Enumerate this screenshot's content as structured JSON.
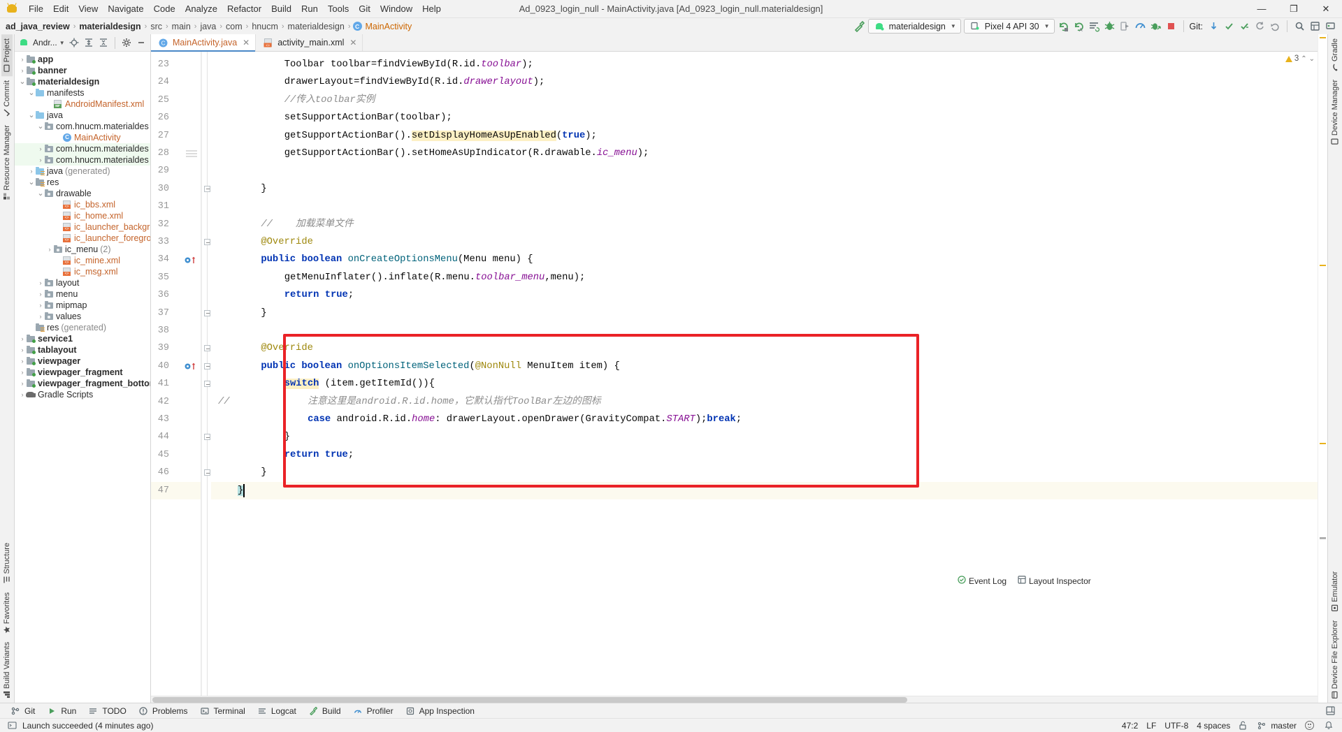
{
  "window": {
    "title": "Ad_0923_login_null - MainActivity.java [Ad_0923_login_null.materialdesign]",
    "minimize": "—",
    "maximize": "❐",
    "close": "✕"
  },
  "menubar": {
    "items": [
      {
        "label": "File"
      },
      {
        "label": "Edit"
      },
      {
        "label": "View"
      },
      {
        "label": "Navigate"
      },
      {
        "label": "Code"
      },
      {
        "label": "Analyze"
      },
      {
        "label": "Refactor"
      },
      {
        "label": "Build"
      },
      {
        "label": "Run"
      },
      {
        "label": "Tools"
      },
      {
        "label": "Git"
      },
      {
        "label": "Window"
      },
      {
        "label": "Help"
      }
    ]
  },
  "breadcrumb": {
    "items": [
      {
        "label": "ad_java_review",
        "style": "bold"
      },
      {
        "label": "materialdesign",
        "style": "bold"
      },
      {
        "label": "src",
        "style": "dim"
      },
      {
        "label": "main",
        "style": "dim"
      },
      {
        "label": "java",
        "style": "dim"
      },
      {
        "label": "com",
        "style": "dim"
      },
      {
        "label": "hnucm",
        "style": "dim"
      },
      {
        "label": "materialdesign",
        "style": "dim"
      },
      {
        "label": "MainActivity",
        "style": "class"
      }
    ],
    "separator": "›",
    "class_badge": "C"
  },
  "toolbar": {
    "run_config": "materialdesign",
    "device": "Pixel 4 API 30",
    "git_label": "Git:",
    "icons": [
      "hammer-build-icon",
      "run-icon",
      "run-with-coverage-icon",
      "run-tests-icon",
      "debug-icon",
      "attach-debugger-icon",
      "profiler-icon",
      "apply-changes-icon",
      "stop-icon",
      "git-update-icon",
      "git-commit-icon",
      "git-push-icon",
      "git-history-icon",
      "undo-icon",
      "search-everywhere-icon",
      "project-structure-icon",
      "settings-icon",
      "sdk-manager-icon"
    ]
  },
  "left_strip": {
    "top": [
      {
        "label": "Project",
        "icon": "project-icon",
        "selected": true
      },
      {
        "label": "Commit",
        "icon": "commit-icon",
        "selected": false
      },
      {
        "label": "Resource Manager",
        "icon": "resource-manager-icon",
        "selected": false
      }
    ],
    "bottom": [
      {
        "label": "Structure",
        "icon": "structure-icon"
      },
      {
        "label": "Favorites",
        "icon": "favorites-star-icon"
      },
      {
        "label": "Build Variants",
        "icon": "build-variants-icon"
      }
    ]
  },
  "right_strip": {
    "items": [
      {
        "label": "Gradle",
        "icon": "gradle-icon"
      },
      {
        "label": "Device Manager",
        "icon": "device-manager-icon"
      },
      {
        "label": "Emulator",
        "icon": "emulator-icon"
      },
      {
        "label": "Device File Explorer",
        "icon": "device-file-explorer-icon"
      }
    ]
  },
  "project_panel": {
    "title": "Andr...",
    "header_icons": [
      "locate-icon",
      "expand-all-icon",
      "collapse-all-icon",
      "gear-icon",
      "hide-icon"
    ],
    "tree": [
      {
        "indent": 0,
        "arrow": "›",
        "icon": "module-folder",
        "label": "app",
        "style": "bold"
      },
      {
        "indent": 0,
        "arrow": "›",
        "icon": "module-folder",
        "label": "banner",
        "style": "bold"
      },
      {
        "indent": 0,
        "arrow": "⌄",
        "icon": "module-folder",
        "label": "materialdesign",
        "style": "bold"
      },
      {
        "indent": 1,
        "arrow": "⌄",
        "icon": "blue-folder",
        "label": "manifests",
        "style": "plain"
      },
      {
        "indent": 3,
        "arrow": "",
        "icon": "manifest-file",
        "label": "AndroidManifest.xml",
        "style": "orange"
      },
      {
        "indent": 1,
        "arrow": "⌄",
        "icon": "blue-folder",
        "label": "java",
        "style": "plain"
      },
      {
        "indent": 2,
        "arrow": "⌄",
        "icon": "package",
        "label": "com.hnucm.materialdes",
        "style": "plain"
      },
      {
        "indent": 4,
        "arrow": "",
        "icon": "class-file",
        "label": "MainActivity",
        "style": "orange"
      },
      {
        "indent": 2,
        "arrow": "›",
        "icon": "package",
        "label": "com.hnucm.materialdes",
        "style": "plain",
        "row": "hl"
      },
      {
        "indent": 2,
        "arrow": "›",
        "icon": "package",
        "label": "com.hnucm.materialdes",
        "style": "plain",
        "row": "hl"
      },
      {
        "indent": 1,
        "arrow": "›",
        "icon": "gen-folder",
        "label": "java",
        "suffix": "(generated)",
        "style": "plain"
      },
      {
        "indent": 1,
        "arrow": "⌄",
        "icon": "res-folder",
        "label": "res",
        "style": "plain"
      },
      {
        "indent": 2,
        "arrow": "⌄",
        "icon": "package",
        "label": "drawable",
        "style": "plain"
      },
      {
        "indent": 4,
        "arrow": "",
        "icon": "xml-file",
        "label": "ic_bbs.xml",
        "style": "orange"
      },
      {
        "indent": 4,
        "arrow": "",
        "icon": "xml-file",
        "label": "ic_home.xml",
        "style": "orange"
      },
      {
        "indent": 4,
        "arrow": "",
        "icon": "xml-file",
        "label": "ic_launcher_backgrou",
        "style": "orange"
      },
      {
        "indent": 4,
        "arrow": "",
        "icon": "xml-file",
        "label": "ic_launcher_foregrou",
        "style": "orange"
      },
      {
        "indent": 3,
        "arrow": "›",
        "icon": "package",
        "label": "ic_menu",
        "suffix": "(2)",
        "style": "plain"
      },
      {
        "indent": 4,
        "arrow": "",
        "icon": "xml-file",
        "label": "ic_mine.xml",
        "style": "orange"
      },
      {
        "indent": 4,
        "arrow": "",
        "icon": "xml-file",
        "label": "ic_msg.xml",
        "style": "orange"
      },
      {
        "indent": 2,
        "arrow": "›",
        "icon": "package",
        "label": "layout",
        "style": "plain"
      },
      {
        "indent": 2,
        "arrow": "›",
        "icon": "package",
        "label": "menu",
        "style": "plain"
      },
      {
        "indent": 2,
        "arrow": "›",
        "icon": "package",
        "label": "mipmap",
        "style": "plain"
      },
      {
        "indent": 2,
        "arrow": "›",
        "icon": "package",
        "label": "values",
        "style": "plain"
      },
      {
        "indent": 1,
        "arrow": "",
        "icon": "res-folder",
        "label": "res",
        "suffix": "(generated)",
        "style": "plain"
      },
      {
        "indent": 0,
        "arrow": "›",
        "icon": "module-folder",
        "label": "service1",
        "style": "bold"
      },
      {
        "indent": 0,
        "arrow": "›",
        "icon": "module-folder",
        "label": "tablayout",
        "style": "bold"
      },
      {
        "indent": 0,
        "arrow": "›",
        "icon": "module-folder",
        "label": "viewpager",
        "style": "bold"
      },
      {
        "indent": 0,
        "arrow": "›",
        "icon": "module-folder",
        "label": "viewpager_fragment",
        "style": "bold"
      },
      {
        "indent": 0,
        "arrow": "›",
        "icon": "module-folder",
        "label": "viewpager_fragment_bottom",
        "style": "bold"
      },
      {
        "indent": 0,
        "arrow": "›",
        "icon": "gradle",
        "label": "Gradle Scripts",
        "style": "plain"
      }
    ]
  },
  "editor": {
    "tabs": [
      {
        "label": "MainActivity.java",
        "icon": "java-class-icon",
        "active": true,
        "close": "✕"
      },
      {
        "label": "activity_main.xml",
        "icon": "xml-file-icon",
        "active": false,
        "close": "✕"
      }
    ],
    "inspection": {
      "count": "3",
      "icon": "warning-triangle-icon",
      "up": "⌃",
      "down": "⌄"
    },
    "first_line_number": 23,
    "lines": [
      {
        "n": 23,
        "indent": 2,
        "tokens": [
          {
            "t": "Toolbar toolbar=findViewById(R.id.",
            "c": ""
          },
          {
            "t": "toolbar",
            "c": "field"
          },
          {
            "t": ");",
            "c": ""
          }
        ]
      },
      {
        "n": 24,
        "indent": 2,
        "tokens": [
          {
            "t": "drawerLayout=findViewById(R.id.",
            "c": ""
          },
          {
            "t": "drawerlayout",
            "c": "field"
          },
          {
            "t": ");",
            "c": ""
          }
        ]
      },
      {
        "n": 25,
        "indent": 2,
        "tokens": [
          {
            "t": "//传入toolbar实例",
            "c": "cmt"
          }
        ]
      },
      {
        "n": 26,
        "indent": 2,
        "tokens": [
          {
            "t": "setSupportActionBar(toolbar);",
            "c": ""
          }
        ]
      },
      {
        "n": 27,
        "indent": 2,
        "tokens": [
          {
            "t": "getSupportActionBar().",
            "c": ""
          },
          {
            "t": "setDisplayHomeAsUpEnabled",
            "c": "hl"
          },
          {
            "t": "(",
            "c": ""
          },
          {
            "t": "true",
            "c": "kw"
          },
          {
            "t": ");",
            "c": ""
          }
        ]
      },
      {
        "n": 28,
        "indent": 2,
        "tokens": [
          {
            "t": "getSupportActionBar().setHomeAsUpIndicator(R.drawable.",
            "c": ""
          },
          {
            "t": "ic_menu",
            "c": "field"
          },
          {
            "t": ");",
            "c": ""
          }
        ]
      },
      {
        "n": 29,
        "indent": 0,
        "tokens": []
      },
      {
        "n": 30,
        "indent": 1,
        "tokens": [
          {
            "t": "}",
            "c": ""
          }
        ]
      },
      {
        "n": 31,
        "indent": 0,
        "tokens": []
      },
      {
        "n": 32,
        "indent": 1,
        "tokens": [
          {
            "t": "//    加载菜单文件",
            "c": "cmt"
          }
        ]
      },
      {
        "n": 33,
        "indent": 1,
        "tokens": [
          {
            "t": "@Override",
            "c": "anno"
          }
        ]
      },
      {
        "n": 34,
        "indent": 1,
        "tokens": [
          {
            "t": "public",
            "c": "kw"
          },
          {
            "t": " ",
            "c": ""
          },
          {
            "t": "boolean",
            "c": "kw"
          },
          {
            "t": " ",
            "c": ""
          },
          {
            "t": "onCreateOptionsMenu",
            "c": "meth"
          },
          {
            "t": "(Menu menu) {",
            "c": ""
          }
        ]
      },
      {
        "n": 35,
        "indent": 2,
        "tokens": [
          {
            "t": "getMenuInflater().inflate(R.menu.",
            "c": ""
          },
          {
            "t": "toolbar_menu",
            "c": "field"
          },
          {
            "t": ",menu);",
            "c": ""
          }
        ]
      },
      {
        "n": 36,
        "indent": 2,
        "tokens": [
          {
            "t": "return",
            "c": "kw"
          },
          {
            "t": " ",
            "c": ""
          },
          {
            "t": "true",
            "c": "kw"
          },
          {
            "t": ";",
            "c": ""
          }
        ]
      },
      {
        "n": 37,
        "indent": 1,
        "tokens": [
          {
            "t": "}",
            "c": ""
          }
        ]
      },
      {
        "n": 38,
        "indent": 0,
        "tokens": []
      },
      {
        "n": 39,
        "indent": 1,
        "tokens": [
          {
            "t": "@Override",
            "c": "anno"
          }
        ]
      },
      {
        "n": 40,
        "indent": 1,
        "tokens": [
          {
            "t": "public",
            "c": "kw"
          },
          {
            "t": " ",
            "c": ""
          },
          {
            "t": "boolean",
            "c": "kw"
          },
          {
            "t": " ",
            "c": ""
          },
          {
            "t": "onOptionsItemSelected",
            "c": "meth"
          },
          {
            "t": "(",
            "c": ""
          },
          {
            "t": "@NonNull",
            "c": "anno"
          },
          {
            "t": " MenuItem item) {",
            "c": ""
          }
        ]
      },
      {
        "n": 41,
        "indent": 2,
        "tokens": [
          {
            "t": "switch",
            "c": "kwhl"
          },
          {
            "t": " (item.getItemId()){",
            "c": ""
          }
        ]
      },
      {
        "n": 42,
        "indent": 3,
        "tokens": [
          {
            "t": "注意这里是android.R.id.home，它默认指代ToolBar左边的图标",
            "c": "cmt"
          }
        ],
        "prefix_comment": "//"
      },
      {
        "n": 43,
        "indent": 3,
        "tokens": [
          {
            "t": "case",
            "c": "kw"
          },
          {
            "t": " android.R.id.",
            "c": ""
          },
          {
            "t": "home",
            "c": "field"
          },
          {
            "t": ": drawerLayout.openDrawer(GravityCompat.",
            "c": ""
          },
          {
            "t": "START",
            "c": "field"
          },
          {
            "t": ");",
            "c": ""
          },
          {
            "t": "break",
            "c": "kw"
          },
          {
            "t": ";",
            "c": ""
          }
        ]
      },
      {
        "n": 44,
        "indent": 2,
        "tokens": [
          {
            "t": "}",
            "c": ""
          }
        ]
      },
      {
        "n": 45,
        "indent": 2,
        "tokens": [
          {
            "t": "return",
            "c": "kw"
          },
          {
            "t": " ",
            "c": ""
          },
          {
            "t": "true",
            "c": "kw"
          },
          {
            "t": ";",
            "c": ""
          }
        ]
      },
      {
        "n": 46,
        "indent": 1,
        "tokens": [
          {
            "t": "}",
            "c": ""
          }
        ]
      },
      {
        "n": 47,
        "indent": 0,
        "tokens": [
          {
            "t": "}",
            "c": "sel"
          }
        ]
      }
    ],
    "annotation": {
      "redbox_label": "highlight-region",
      "color": "#ea2227"
    }
  },
  "bottom_tools": {
    "items": [
      {
        "label": "Git",
        "icon": "git-branch-icon"
      },
      {
        "label": "Run",
        "icon": "run-play-icon"
      },
      {
        "label": "TODO",
        "icon": "todo-list-icon"
      },
      {
        "label": "Problems",
        "icon": "problems-icon"
      },
      {
        "label": "Terminal",
        "icon": "terminal-icon"
      },
      {
        "label": "Logcat",
        "icon": "logcat-icon"
      },
      {
        "label": "Build",
        "icon": "build-hammer-icon"
      },
      {
        "label": "Profiler",
        "icon": "profiler-icon"
      },
      {
        "label": "App Inspection",
        "icon": "app-inspection-icon"
      }
    ],
    "right_icons": [
      "layout-settings-icon"
    ]
  },
  "statusbar": {
    "message": "Launch succeeded (4 minutes ago)",
    "message_icon": "terminal-square-icon",
    "event_log": "Event Log",
    "layout_inspector": "Layout Inspector",
    "caret": "47:2",
    "line_sep": "LF",
    "encoding": "UTF-8",
    "indent": "4 spaces",
    "branch": "master",
    "branch_icon": "git-branch-icon",
    "lock_icon": "lock-open-icon",
    "smiley_icon": "smiley-icon",
    "notifications_icon": "bell-icon"
  },
  "colors": {
    "accent_blue": "#4a88c7",
    "red_highlight": "#ea2227",
    "orange_file": "#c4632a",
    "green_module": "#43a047",
    "caret_line": "#fcfaef"
  }
}
